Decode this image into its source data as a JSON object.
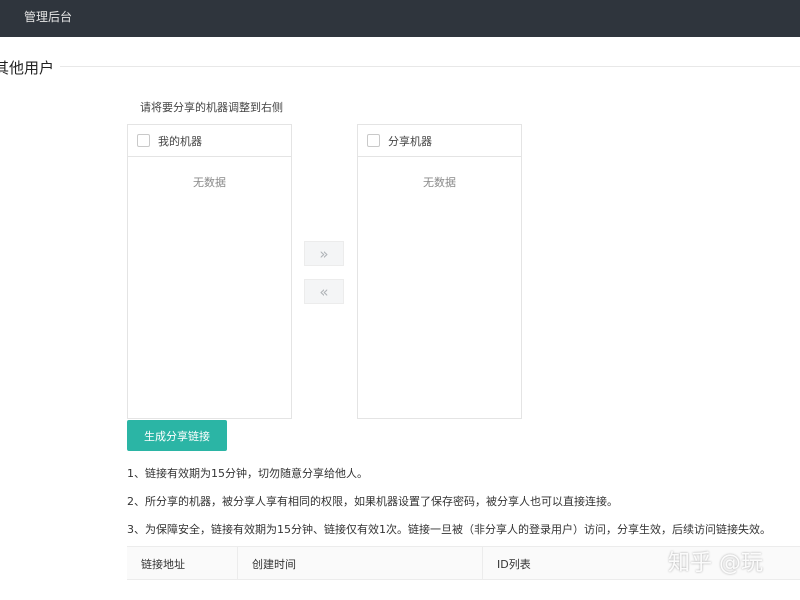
{
  "topbar": {
    "title": "管理后台"
  },
  "section": {
    "title": "其他用户"
  },
  "transfer": {
    "hint": "请将要分享的机器调整到右侧",
    "left": {
      "label": "我的机器",
      "empty": "无数据"
    },
    "right": {
      "label": "分享机器",
      "empty": "无数据"
    },
    "move_right_label": "»",
    "move_left_label": "«"
  },
  "actions": {
    "generate_label": "生成分享链接"
  },
  "notes": [
    "1、链接有效期为15分钟，切勿随意分享给他人。",
    "2、所分享的机器，被分享人享有相同的权限，如果机器设置了保存密码，被分享人也可以直接连接。",
    "3、为保障安全，链接有效期为15分钟、链接仅有效1次。链接一旦被（非分享人的登录用户）访问，分享生效，后续访问链接失效。"
  ],
  "table": {
    "columns": [
      "链接地址",
      "创建时间",
      "ID列表"
    ]
  },
  "watermark": "知乎 @玩"
}
